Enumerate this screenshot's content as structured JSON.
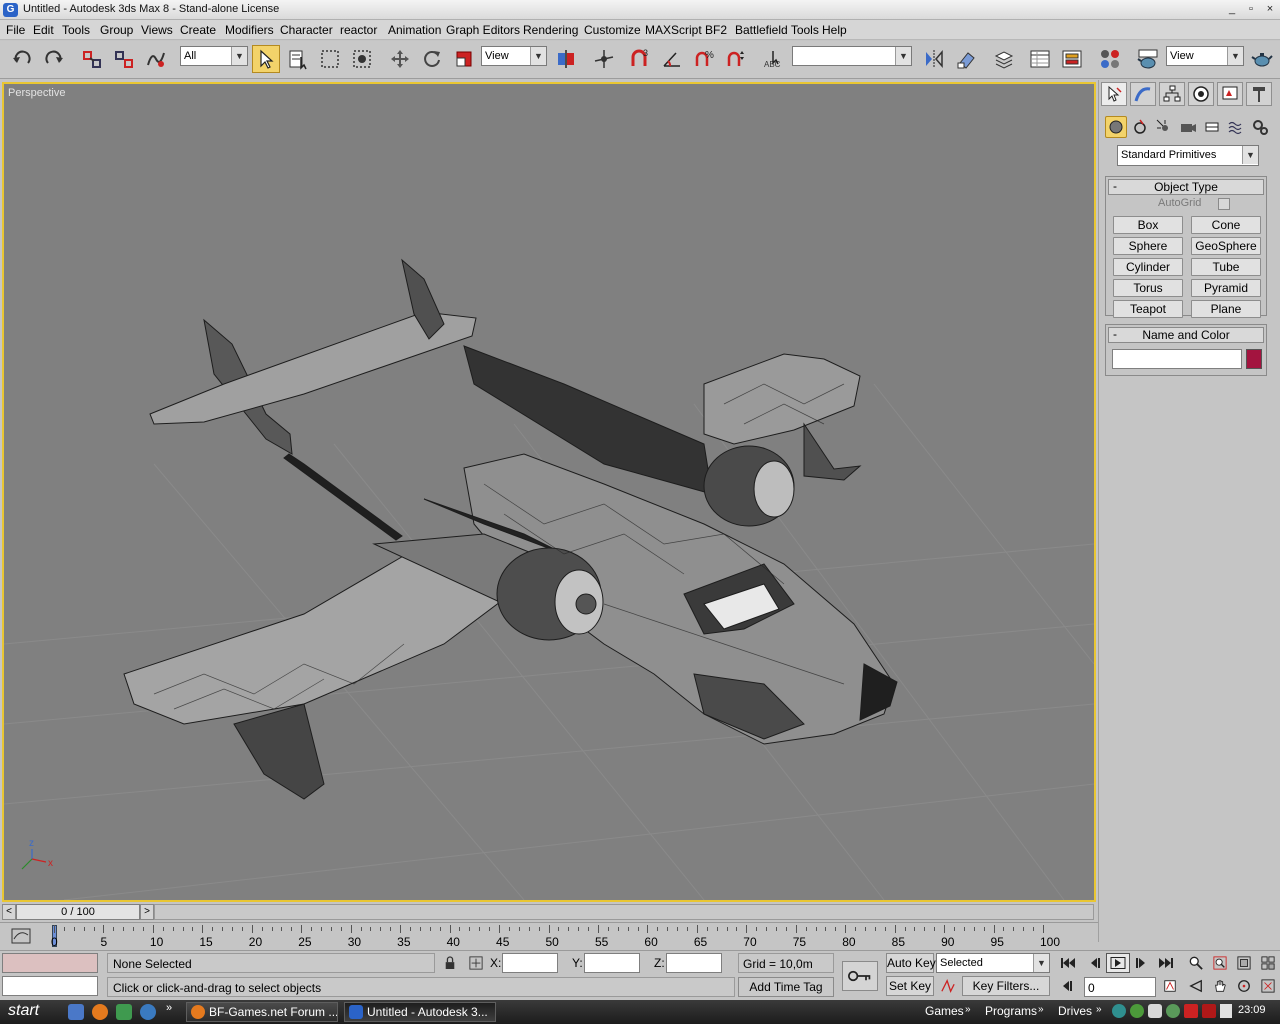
{
  "window": {
    "title": "Untitled - Autodesk 3ds Max 8  - Stand-alone License",
    "controls": [
      "_",
      "▫",
      "×"
    ]
  },
  "menu": [
    "File",
    "Edit",
    "Tools",
    "Group",
    "Views",
    "Create",
    "Modifiers",
    "Character",
    "reactor",
    "Animation",
    "Graph Editors",
    "Rendering",
    "Customize",
    "MAXScript",
    "BF2",
    "Battlefield Tools",
    "Help"
  ],
  "toolbar": {
    "selection_filter": "All",
    "ref_coord": "View",
    "named_selection": "",
    "render_view": "View",
    "snap_label": "3",
    "percent_label": "%"
  },
  "viewport": {
    "label": "Perspective",
    "axis_x": "x",
    "axis_z": "z"
  },
  "command_panel": {
    "category_dropdown": "Standard Primitives",
    "object_type_title": "Object Type",
    "autogrid_label": "AutoGrid",
    "primitives": [
      "Box",
      "Cone",
      "Sphere",
      "GeoSphere",
      "Cylinder",
      "Tube",
      "Torus",
      "Pyramid",
      "Teapot",
      "Plane"
    ],
    "name_color_title": "Name and Color",
    "name_value": "",
    "object_color": "#a3143f",
    "rollout_minus": "-"
  },
  "timeline": {
    "frame_display": "0 / 100",
    "ticks": [
      "0",
      "5",
      "10",
      "15",
      "20",
      "25",
      "30",
      "35",
      "40",
      "45",
      "50",
      "55",
      "60",
      "65",
      "70",
      "75",
      "80",
      "85",
      "90",
      "95",
      "100"
    ]
  },
  "status": {
    "selection": "None Selected",
    "prompt": "Click or click-and-drag to select objects",
    "x_label": "X:",
    "y_label": "Y:",
    "z_label": "Z:",
    "x_value": "",
    "y_value": "",
    "z_value": "",
    "grid": "Grid = 10,0m",
    "add_time_tag": "Add Time Tag",
    "auto_key": "Auto Key",
    "set_key": "Set Key",
    "key_mode": "Selected",
    "key_filters": "Key Filters...",
    "current_frame": "0"
  },
  "taskbar": {
    "start": "start",
    "tasks": [
      "BF-Games.net Forum ...",
      "Untitled - Autodesk 3..."
    ],
    "toolbars": [
      "Games",
      "Programs",
      "Drives"
    ],
    "clock": "23:09"
  }
}
